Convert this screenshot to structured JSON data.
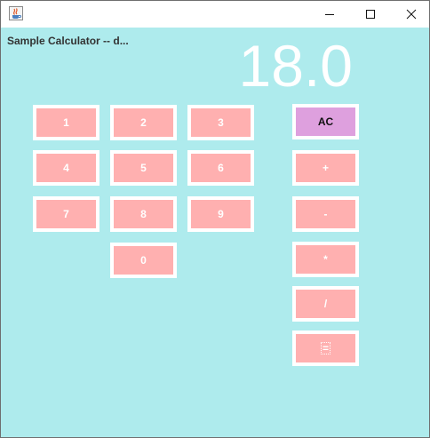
{
  "window": {
    "title": ""
  },
  "panel": {
    "title": "Sample Calculator -- d..."
  },
  "display": {
    "value": "18.0"
  },
  "keys": {
    "k1": "1",
    "k2": "2",
    "k3": "3",
    "k4": "4",
    "k5": "5",
    "k6": "6",
    "k7": "7",
    "k8": "8",
    "k9": "9",
    "k0": "0",
    "ac": "AC",
    "plus": "+",
    "minus": "-",
    "times": "*",
    "divide": "/",
    "equals": "="
  },
  "icons": {
    "app": "java-coffee-cup-icon",
    "minimize": "minimize-icon",
    "maximize": "maximize-icon",
    "close": "close-icon"
  },
  "colors": {
    "background": "#aeebed",
    "digit_button": "#ffb0b0",
    "clear_button": "#dea0de",
    "display_text": "#ffffff"
  }
}
